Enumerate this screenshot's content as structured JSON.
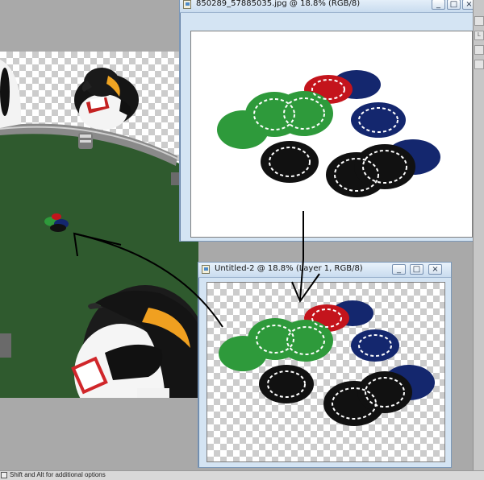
{
  "windows": {
    "source": {
      "title": "850289_57885035.jpg @ 18.8% (RGB/8)",
      "buttons": {
        "minimize": "_",
        "maximize": "□",
        "close": "×"
      }
    },
    "untitled": {
      "title": "Untitled-2 @ 18.8% (Layer 1, RGB/8)",
      "buttons": {
        "minimize": "_",
        "maximize": "□",
        "close": "×"
      }
    }
  },
  "status_bar": {
    "text": "Shift and Alt for additional options"
  },
  "right_panel": {
    "tabs": [
      "",
      "L",
      "",
      ""
    ]
  },
  "colors": {
    "table_felt": "#2f5a2e",
    "chip_green": "#2e9a3b",
    "chip_red": "#c4141c",
    "chip_blue": "#14276e",
    "chip_black": "#111111"
  }
}
